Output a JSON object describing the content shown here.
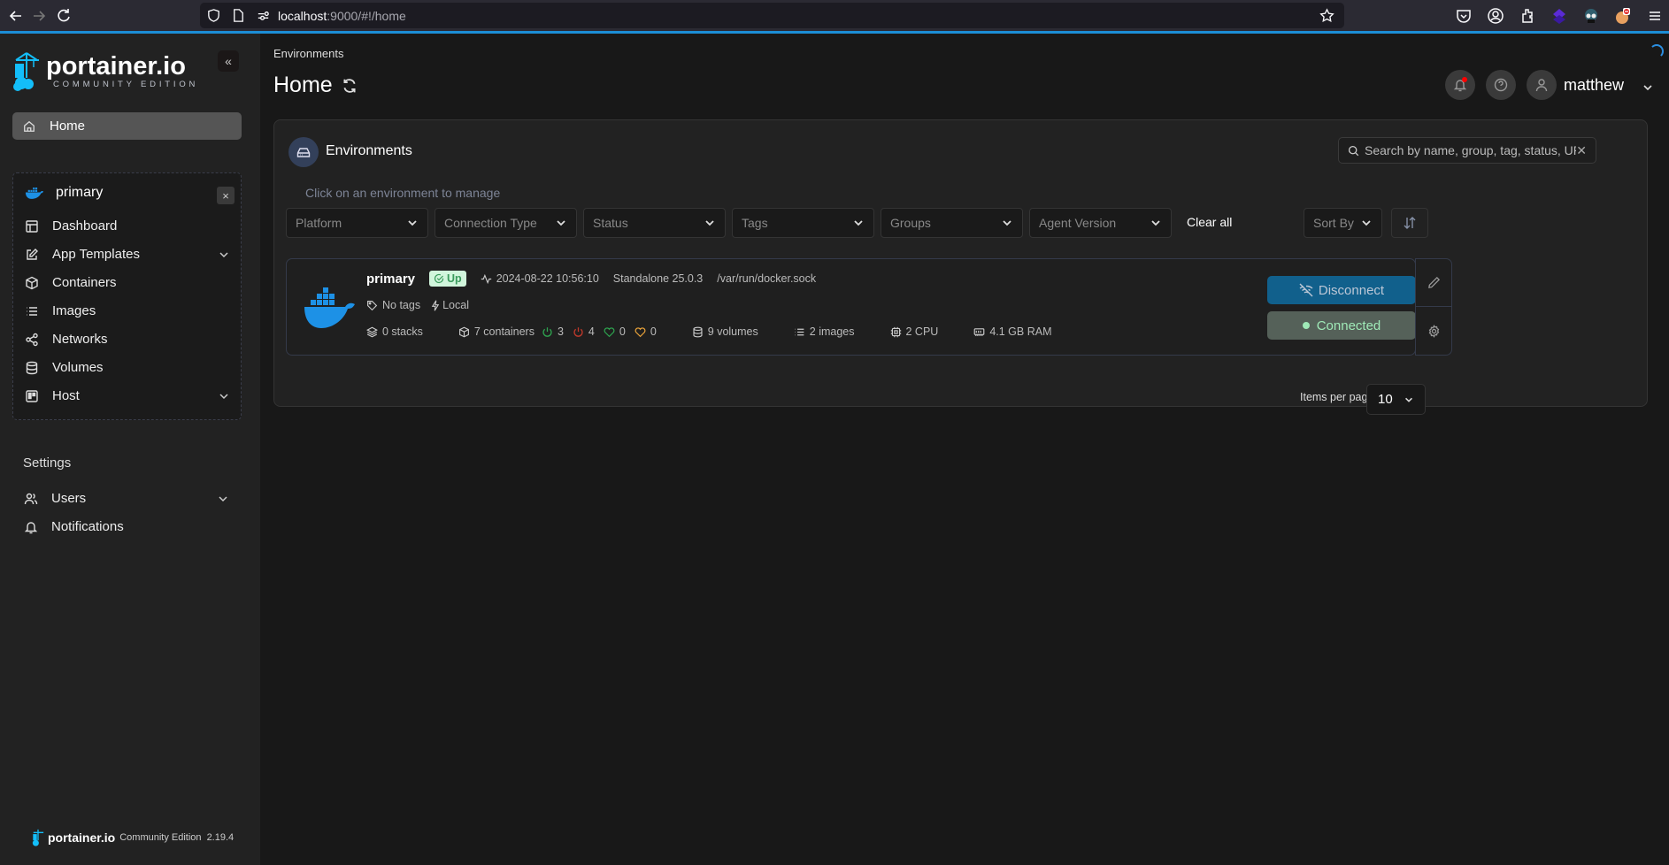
{
  "browser": {
    "url_host": "localhost",
    "url_rest": ":9000/#!/home",
    "icons": [
      "back-icon",
      "forward-icon",
      "reload-icon",
      "shield-icon",
      "page-icon",
      "permissions-icon",
      "bookmark-star-icon",
      "pocket-icon",
      "account-icon",
      "extensions-icon",
      "extension-purple-icon",
      "extension-goggles-icon",
      "extension-fox-icon",
      "menu-icon"
    ]
  },
  "sidebar": {
    "logo_name": "portainer.io",
    "logo_edition": "COMMUNITY EDITION",
    "collapse_label": "«",
    "home_label": "Home",
    "environment": {
      "name": "primary",
      "close_label": "×",
      "items": [
        {
          "label": "Dashboard",
          "icon": "dashboard-icon"
        },
        {
          "label": "App Templates",
          "icon": "edit-icon",
          "expandable": true
        },
        {
          "label": "Containers",
          "icon": "box-icon"
        },
        {
          "label": "Images",
          "icon": "list-icon"
        },
        {
          "label": "Networks",
          "icon": "share-icon"
        },
        {
          "label": "Volumes",
          "icon": "database-icon"
        },
        {
          "label": "Host",
          "icon": "trello-icon",
          "expandable": true
        }
      ]
    },
    "settings_label": "Settings",
    "settings_items": [
      {
        "label": "Users",
        "icon": "users-icon",
        "expandable": true
      },
      {
        "label": "Notifications",
        "icon": "bell-icon"
      }
    ],
    "footer": {
      "name": "portainer.io",
      "edition": "Community Edition",
      "version": "2.19.4"
    }
  },
  "header": {
    "breadcrumb": "Environments",
    "title": "Home",
    "username": "matthew"
  },
  "environments": {
    "title": "Environments",
    "search_placeholder": "Search by name, group, tag, status, URL...",
    "search_value": "",
    "hint": "Click on an environment to manage",
    "filters": [
      "Platform",
      "Connection Type",
      "Status",
      "Tags",
      "Groups",
      "Agent Version"
    ],
    "clear_all": "Clear all",
    "sort_by": "Sort By",
    "items": [
      {
        "name": "primary",
        "status": "Up",
        "heartbeat": "2024-08-22 10:56:10",
        "type": "Standalone 25.0.3",
        "url": "/var/run/docker.sock",
        "tags": "No tags",
        "connection": "Local",
        "stacks": "0 stacks",
        "containers": "7 containers",
        "running": "3",
        "stopped": "4",
        "healthy": "0",
        "unhealthy": "0",
        "volumes": "9 volumes",
        "images": "2 images",
        "cpu": "2 CPU",
        "ram": "4.1 GB RAM",
        "disconnect_label": "Disconnect",
        "connected_label": "Connected"
      }
    ],
    "items_per_page_label": "Items per page",
    "items_per_page": "10"
  },
  "colors": {
    "accent": "#1c8ed6",
    "disconnect_bg": "#11608c",
    "connected_bg": "#556159",
    "connected_text": "#9fe9b7",
    "up_badge_bg": "#d1f5dc",
    "running": "#2ea44f",
    "stopped": "#c0392b",
    "healthy": "#2ea44f",
    "unhealthy": "#e8a23a"
  }
}
